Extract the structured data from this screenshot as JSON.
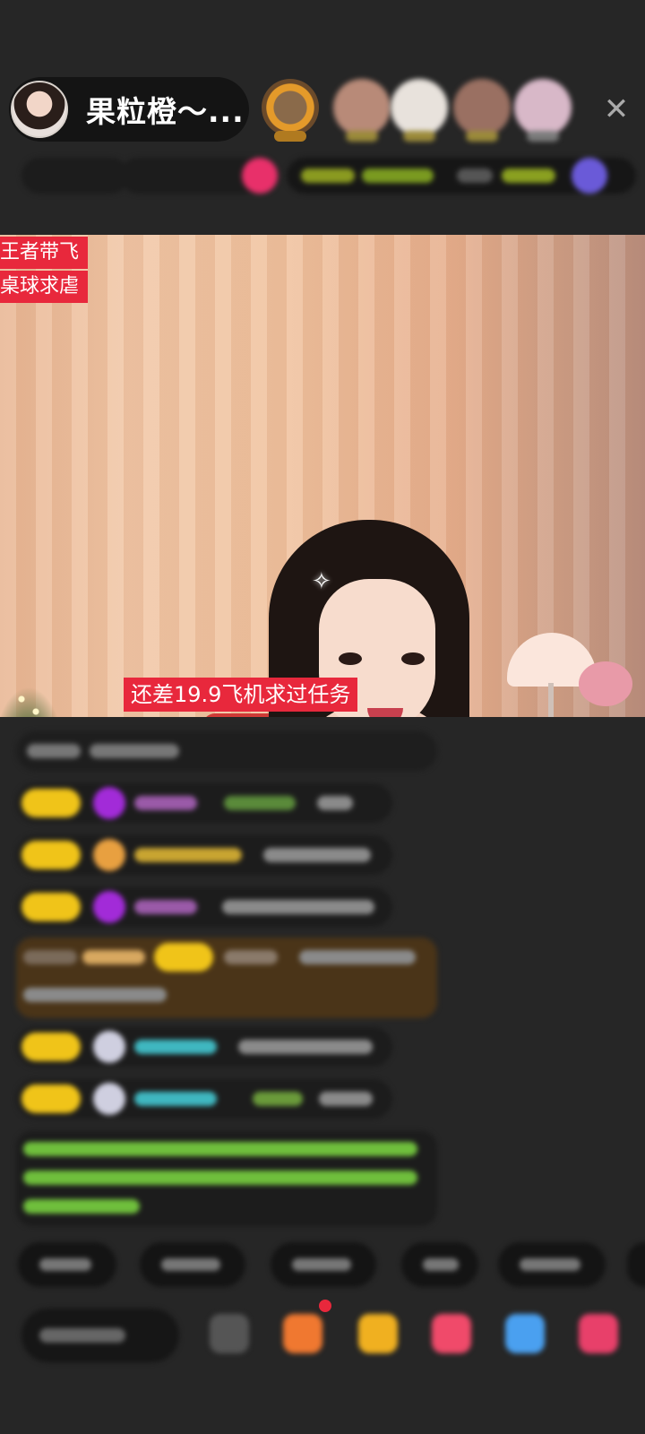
{
  "header": {
    "host_name": "果粒橙～...",
    "close_glyph": "✕"
  },
  "video": {
    "tags": [
      "王者带飞",
      "桌球求虐"
    ],
    "subtitle": "还差19.9飞机求过任务"
  },
  "colors": {
    "tag_red": "#e8283c",
    "level_badge": "#f0c419",
    "vip_purple": "#a22bd8",
    "gold_username": "#c8a431",
    "cyan_username": "#3fb7c0",
    "green_message": "#6fbf3c"
  },
  "icons": [
    "host-avatar",
    "viewer-avatar",
    "close-icon",
    "gift-icon",
    "red-packet-icon",
    "chest-icon",
    "heart-box-icon",
    "controller-icon"
  ]
}
